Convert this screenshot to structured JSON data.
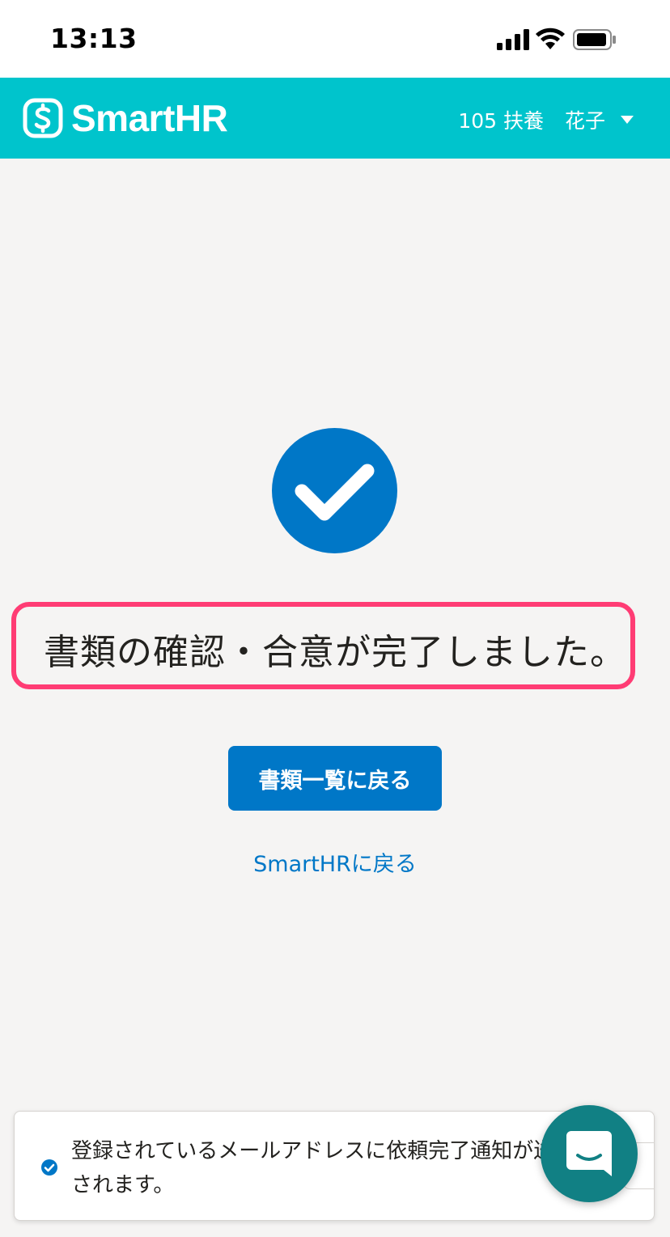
{
  "status_bar": {
    "time": "13:13",
    "icons": [
      "signal-icon",
      "wifi-icon",
      "battery-icon"
    ]
  },
  "header": {
    "logo_text": "SmartHR",
    "company_label": "105 扶養",
    "user_given_name": "花子",
    "background_color": "#00c4cc"
  },
  "main": {
    "status_icon": "check-circle-icon",
    "message": "書類の確認・合意が完了しました。",
    "primary_button_label": "書類一覧に戻る",
    "secondary_link_label": "SmartHRに戻る",
    "accent_color": "#0077c7",
    "highlight_color": "#ff3c74"
  },
  "notification": {
    "text": "登録されているメールアドレスに依頼完了通知が送信されます。",
    "icon": "check-circle-small-icon"
  },
  "chat_button": {
    "icon": "chat-icon",
    "color": "#118084"
  }
}
